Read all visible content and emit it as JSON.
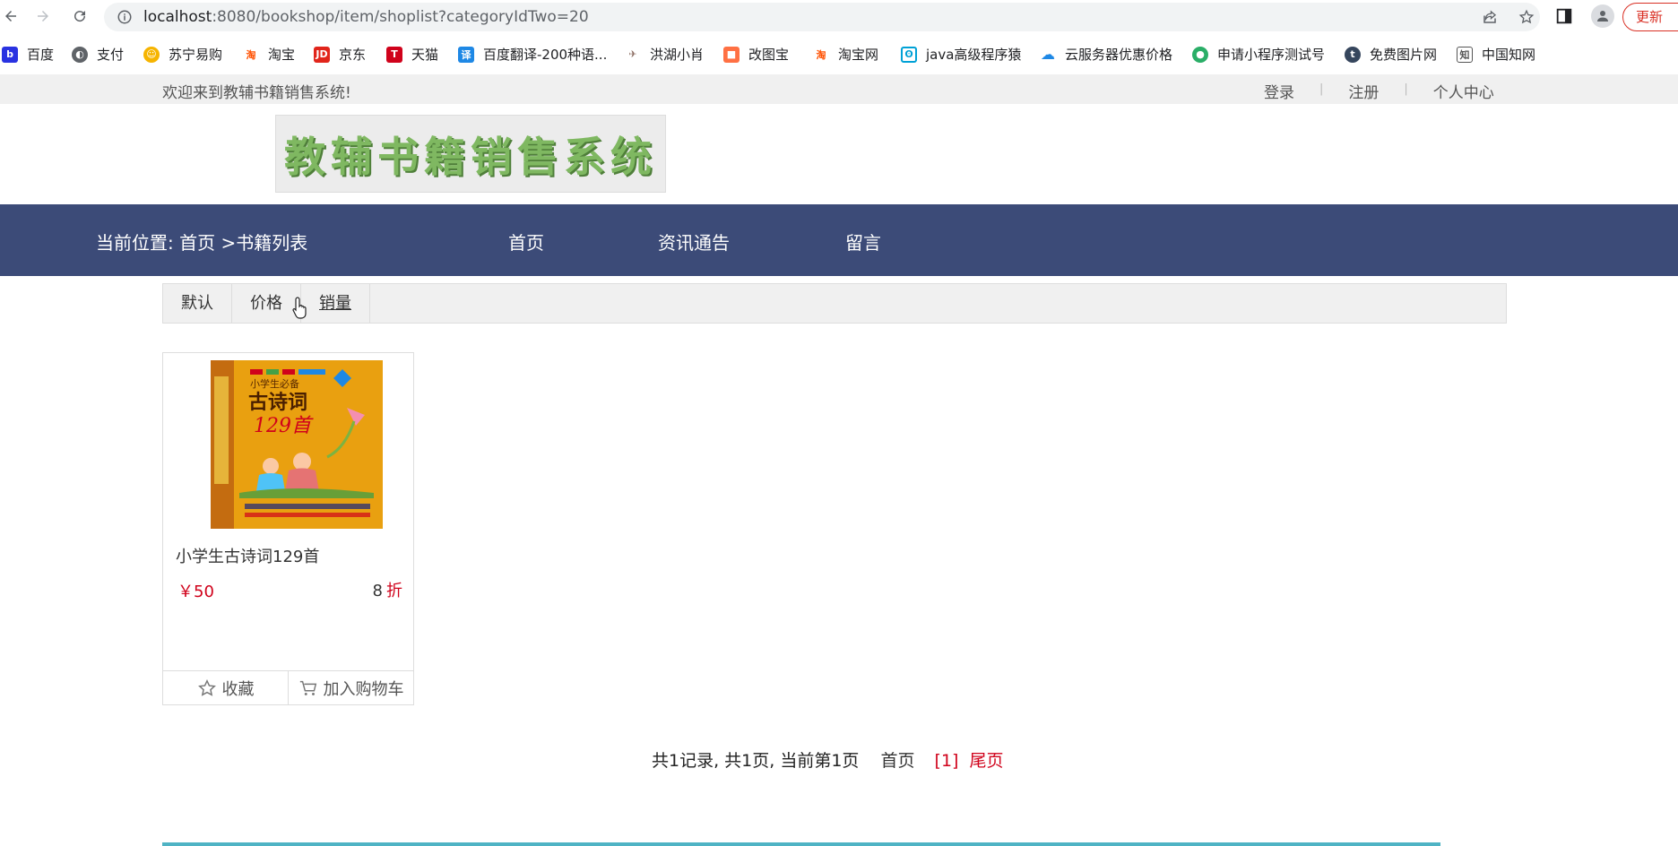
{
  "browser": {
    "url_host": "localhost",
    "url_rest": ":8080/bookshop/item/shoplist?categoryIdTwo=20",
    "update_label": "更新"
  },
  "bookmarks": [
    {
      "label": "百度",
      "icon": "baidu-icon",
      "color": "#2932e1"
    },
    {
      "label": "支付",
      "icon": "globe-icon",
      "color": "#5f6368"
    },
    {
      "label": "苏宁易购",
      "icon": "suning-icon",
      "color": "#f6b400"
    },
    {
      "label": "淘宝",
      "icon": "taobao-icon",
      "color": "#ff5000"
    },
    {
      "label": "京东",
      "icon": "jd-icon",
      "color": "#e1251b"
    },
    {
      "label": "天猫",
      "icon": "tmall-icon",
      "color": "#d0021b"
    },
    {
      "label": "百度翻译-200种语...",
      "icon": "translate-icon",
      "color": "#1e88e5"
    },
    {
      "label": "洪湖小肖",
      "icon": "bird-icon",
      "color": "#8d6e63"
    },
    {
      "label": "改图宝",
      "icon": "gaitubao-icon",
      "color": "#ff7043"
    },
    {
      "label": "淘宝网",
      "icon": "taobao-icon",
      "color": "#ff5000"
    },
    {
      "label": "java高级程序猿",
      "icon": "bilibili-icon",
      "color": "#00a1d6"
    },
    {
      "label": "云服务器优惠价格",
      "icon": "cloud-icon",
      "color": "#1e88e5"
    },
    {
      "label": "申请小程序测试号",
      "icon": "wechat-icon",
      "color": "#2aae67"
    },
    {
      "label": "免费图片网",
      "icon": "tumblr-icon",
      "color": "#36465d"
    },
    {
      "label": "中国知网",
      "icon": "cnki-icon",
      "color": "#555555"
    }
  ],
  "site": {
    "welcome": "欢迎来到教辅书籍销售系统!",
    "login": "登录",
    "register": "注册",
    "user_center": "个人中心",
    "logo_text": "教辅书籍销售系统",
    "breadcrumb": "当前位置: 首页 >书籍列表",
    "nav": [
      "首页",
      "资讯通告",
      "留言"
    ]
  },
  "sort": [
    "默认",
    "价格",
    "销量"
  ],
  "product": {
    "title": "小学生古诗词129首",
    "price": "￥50",
    "discount_num": "8",
    "discount_unit": "折",
    "favorite": "收藏",
    "add_cart": "加入购物车",
    "cover_text": "古诗词",
    "cover_num": "129首"
  },
  "pager": {
    "summary": "共1记录, 共1页,  当前第1页",
    "first": "首页",
    "current": "[1]",
    "last": "尾页"
  }
}
